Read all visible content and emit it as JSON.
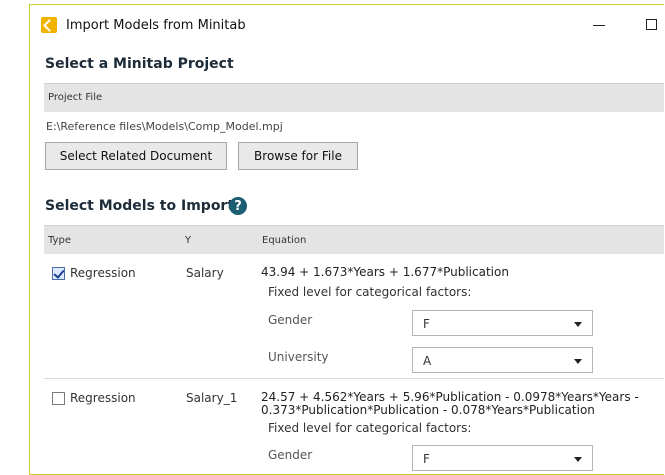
{
  "window": {
    "title": "Import Models from Minitab",
    "app_icon": "minitab-import-icon"
  },
  "project": {
    "heading": "Select a Minitab Project",
    "file_header": "Project File",
    "path": "E:\\Reference files\\Models\\Comp_Model.mpj",
    "btn_related": "Select Related Document",
    "btn_browse": "Browse for File"
  },
  "models": {
    "heading": "Select Models to Import",
    "help_glyph": "?",
    "columns": {
      "type": "Type",
      "y": "Y",
      "equation": "Equation"
    },
    "rows": [
      {
        "checked": true,
        "type": "Regression",
        "y": "Salary",
        "equation": "43.94 + 1.673*Years + 1.677*Publication",
        "fixed_label": "Fixed level for categorical factors:",
        "factors": [
          {
            "name": "Gender",
            "value": "F"
          },
          {
            "name": "University",
            "value": "A"
          }
        ]
      },
      {
        "checked": false,
        "type": "Regression",
        "y": "Salary_1",
        "equation_line1": "24.57 + 4.562*Years + 5.96*Publication - 0.0978*Years*Years -",
        "equation_line2": "0.373*Publication*Publication - 0.078*Years*Publication",
        "fixed_label": "Fixed level for categorical factors:",
        "factors": [
          {
            "name": "Gender",
            "value": "F"
          }
        ]
      }
    ]
  },
  "colors": {
    "accent_border": "#c9d22c",
    "header_bg": "#e4e4e4",
    "help_icon": "#1b5e72"
  }
}
